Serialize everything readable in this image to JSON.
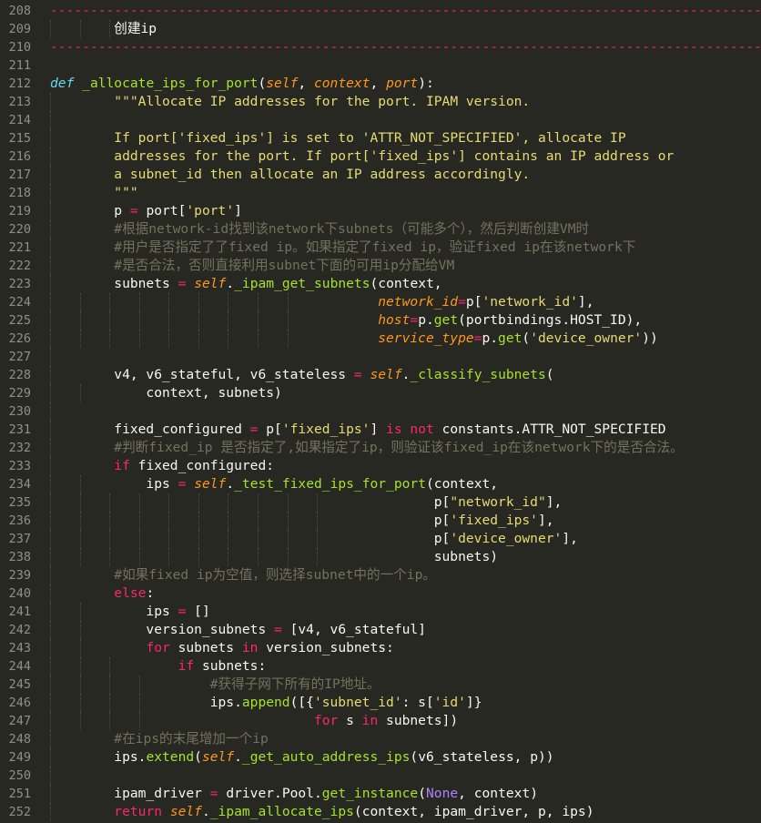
{
  "theme": {
    "background": "#272822",
    "foreground": "#f8f8f2",
    "keyword": "#f92672",
    "function": "#a6e22e",
    "parameter": "#fd971f",
    "string": "#e6db74",
    "comment": "#75715e",
    "builtin": "#66d9ef",
    "constant": "#ae81ff",
    "line_number": "#8f908a"
  },
  "editor": {
    "lines": [
      {
        "n": "208",
        "indent": 0,
        "tokens": [
          [
            "sep",
            "--------------------------------------------------------------------------------------------"
          ]
        ]
      },
      {
        "n": "209",
        "indent": 4,
        "tokens": [
          [
            "pl",
            "        创建ip"
          ]
        ]
      },
      {
        "n": "210",
        "indent": 0,
        "tokens": [
          [
            "sep",
            "--------------------------------------------------------------------------------------------"
          ]
        ]
      },
      {
        "n": "211",
        "indent": 0,
        "tokens": []
      },
      {
        "n": "212",
        "indent": 0,
        "tokens": [
          [
            "def",
            "def"
          ],
          [
            "pl",
            " "
          ],
          [
            "fn",
            "_allocate_ips_for_port"
          ],
          [
            "pl",
            "("
          ],
          [
            "param",
            "self"
          ],
          [
            "pl",
            ", "
          ],
          [
            "param",
            "context"
          ],
          [
            "pl",
            ", "
          ],
          [
            "param",
            "port"
          ],
          [
            "pl",
            "):"
          ]
        ]
      },
      {
        "n": "213",
        "indent": 1,
        "tokens": [
          [
            "pl",
            "        "
          ],
          [
            "ds",
            "\"\"\"Allocate IP addresses for the port. IPAM version."
          ]
        ]
      },
      {
        "n": "214",
        "indent": 1,
        "tokens": []
      },
      {
        "n": "215",
        "indent": 1,
        "tokens": [
          [
            "pl",
            "        "
          ],
          [
            "ds",
            "If port['fixed_ips'] is set to 'ATTR_NOT_SPECIFIED', allocate IP"
          ]
        ]
      },
      {
        "n": "216",
        "indent": 1,
        "tokens": [
          [
            "pl",
            "        "
          ],
          [
            "ds",
            "addresses for the port. If port['fixed_ips'] contains an IP address or"
          ]
        ]
      },
      {
        "n": "217",
        "indent": 1,
        "tokens": [
          [
            "pl",
            "        "
          ],
          [
            "ds",
            "a subnet_id then allocate an IP address accordingly."
          ]
        ]
      },
      {
        "n": "218",
        "indent": 1,
        "tokens": [
          [
            "pl",
            "        "
          ],
          [
            "ds",
            "\"\"\""
          ]
        ]
      },
      {
        "n": "219",
        "indent": 1,
        "tokens": [
          [
            "pl",
            "        p "
          ],
          [
            "op",
            "="
          ],
          [
            "pl",
            " port["
          ],
          [
            "str",
            "'port'"
          ],
          [
            "pl",
            "]"
          ]
        ]
      },
      {
        "n": "220",
        "indent": 1,
        "tokens": [
          [
            "pl",
            "        "
          ],
          [
            "cm",
            "#根据network-id找到该network下subnets（可能多个），然后判断创建VM时"
          ]
        ]
      },
      {
        "n": "221",
        "indent": 1,
        "tokens": [
          [
            "pl",
            "        "
          ],
          [
            "cm",
            "#用户是否指定了了fixed ip。如果指定了fixed ip，验证fixed ip在该network下"
          ]
        ]
      },
      {
        "n": "222",
        "indent": 1,
        "tokens": [
          [
            "pl",
            "        "
          ],
          [
            "cm",
            "#是否合法，否则直接利用subnet下面的可用ip分配给VM"
          ]
        ]
      },
      {
        "n": "223",
        "indent": 1,
        "tokens": [
          [
            "pl",
            "        subnets "
          ],
          [
            "op",
            "="
          ],
          [
            "pl",
            " "
          ],
          [
            "self",
            "self"
          ],
          [
            "pl",
            "."
          ],
          [
            "fn",
            "_ipam_get_subnets"
          ],
          [
            "pl",
            "(context,"
          ]
        ]
      },
      {
        "n": "224",
        "indent": 9,
        "tokens": [
          [
            "pl",
            "                                         "
          ],
          [
            "param",
            "network_id"
          ],
          [
            "op",
            "="
          ],
          [
            "pl",
            "p["
          ],
          [
            "str",
            "'network_id'"
          ],
          [
            "pl",
            "],"
          ]
        ]
      },
      {
        "n": "225",
        "indent": 9,
        "tokens": [
          [
            "pl",
            "                                         "
          ],
          [
            "param",
            "host"
          ],
          [
            "op",
            "="
          ],
          [
            "pl",
            "p."
          ],
          [
            "fn",
            "get"
          ],
          [
            "pl",
            "(portbindings.HOST_ID),"
          ]
        ]
      },
      {
        "n": "226",
        "indent": 9,
        "tokens": [
          [
            "pl",
            "                                         "
          ],
          [
            "param",
            "service_type"
          ],
          [
            "op",
            "="
          ],
          [
            "pl",
            "p."
          ],
          [
            "fn",
            "get"
          ],
          [
            "pl",
            "("
          ],
          [
            "str",
            "'device_owner'"
          ],
          [
            "pl",
            "))"
          ]
        ]
      },
      {
        "n": "227",
        "indent": 1,
        "tokens": []
      },
      {
        "n": "228",
        "indent": 1,
        "tokens": [
          [
            "pl",
            "        v4, v6_stateful, v6_stateless "
          ],
          [
            "op",
            "="
          ],
          [
            "pl",
            " "
          ],
          [
            "self",
            "self"
          ],
          [
            "pl",
            "."
          ],
          [
            "fn",
            "_classify_subnets"
          ],
          [
            "pl",
            "("
          ]
        ]
      },
      {
        "n": "229",
        "indent": 2,
        "tokens": [
          [
            "pl",
            "            context, subnets)"
          ]
        ]
      },
      {
        "n": "230",
        "indent": 1,
        "tokens": []
      },
      {
        "n": "231",
        "indent": 1,
        "tokens": [
          [
            "pl",
            "        fixed_configured "
          ],
          [
            "op",
            "="
          ],
          [
            "pl",
            " p["
          ],
          [
            "str",
            "'fixed_ips'"
          ],
          [
            "pl",
            "] "
          ],
          [
            "kw",
            "is"
          ],
          [
            "pl",
            " "
          ],
          [
            "kw",
            "not"
          ],
          [
            "pl",
            " constants.ATTR_NOT_SPECIFIED"
          ]
        ]
      },
      {
        "n": "232",
        "indent": 1,
        "tokens": [
          [
            "pl",
            "        "
          ],
          [
            "cm",
            "#判断fixed_ip 是否指定了,如果指定了ip，则验证该fixed_ip在该network下的是否合法。"
          ]
        ]
      },
      {
        "n": "233",
        "indent": 1,
        "tokens": [
          [
            "pl",
            "        "
          ],
          [
            "kw",
            "if"
          ],
          [
            "pl",
            " fixed_configured:"
          ]
        ]
      },
      {
        "n": "234",
        "indent": 2,
        "tokens": [
          [
            "pl",
            "            ips "
          ],
          [
            "op",
            "="
          ],
          [
            "pl",
            " "
          ],
          [
            "self",
            "self"
          ],
          [
            "pl",
            "."
          ],
          [
            "fn",
            "_test_fixed_ips_for_port"
          ],
          [
            "pl",
            "(context,"
          ]
        ]
      },
      {
        "n": "235",
        "indent": 10,
        "tokens": [
          [
            "pl",
            "                                                p["
          ],
          [
            "str",
            "\"network_id\""
          ],
          [
            "pl",
            "],"
          ]
        ]
      },
      {
        "n": "236",
        "indent": 10,
        "tokens": [
          [
            "pl",
            "                                                p["
          ],
          [
            "str",
            "'fixed_ips'"
          ],
          [
            "pl",
            "],"
          ]
        ]
      },
      {
        "n": "237",
        "indent": 10,
        "tokens": [
          [
            "pl",
            "                                                p["
          ],
          [
            "str",
            "'device_owner'"
          ],
          [
            "pl",
            "],"
          ]
        ]
      },
      {
        "n": "238",
        "indent": 10,
        "tokens": [
          [
            "pl",
            "                                                subnets)"
          ]
        ]
      },
      {
        "n": "239",
        "indent": 1,
        "tokens": [
          [
            "pl",
            "        "
          ],
          [
            "cm",
            "#如果fixed ip为空值，则选择subnet中的一个ip。"
          ]
        ]
      },
      {
        "n": "240",
        "indent": 1,
        "tokens": [
          [
            "pl",
            "        "
          ],
          [
            "kw",
            "else"
          ],
          [
            "pl",
            ":"
          ]
        ]
      },
      {
        "n": "241",
        "indent": 2,
        "tokens": [
          [
            "pl",
            "            ips "
          ],
          [
            "op",
            "="
          ],
          [
            "pl",
            " []"
          ]
        ]
      },
      {
        "n": "242",
        "indent": 2,
        "tokens": [
          [
            "pl",
            "            version_subnets "
          ],
          [
            "op",
            "="
          ],
          [
            "pl",
            " [v4, v6_stateful]"
          ]
        ]
      },
      {
        "n": "243",
        "indent": 2,
        "tokens": [
          [
            "pl",
            "            "
          ],
          [
            "kw",
            "for"
          ],
          [
            "pl",
            " subnets "
          ],
          [
            "kw",
            "in"
          ],
          [
            "pl",
            " version_subnets:"
          ]
        ]
      },
      {
        "n": "244",
        "indent": 3,
        "tokens": [
          [
            "pl",
            "                "
          ],
          [
            "kw",
            "if"
          ],
          [
            "pl",
            " subnets:"
          ]
        ]
      },
      {
        "n": "245",
        "indent": 4,
        "tokens": [
          [
            "pl",
            "                    "
          ],
          [
            "cm",
            "#获得子网下所有的IP地址。"
          ]
        ]
      },
      {
        "n": "246",
        "indent": 4,
        "tokens": [
          [
            "pl",
            "                    ips."
          ],
          [
            "fn",
            "append"
          ],
          [
            "pl",
            "([{"
          ],
          [
            "str",
            "'subnet_id'"
          ],
          [
            "pl",
            ": s["
          ],
          [
            "str",
            "'id'"
          ],
          [
            "pl",
            "]}"
          ]
        ]
      },
      {
        "n": "247",
        "indent": 4,
        "tokens": [
          [
            "pl",
            "                                 "
          ],
          [
            "kw",
            "for"
          ],
          [
            "pl",
            " s "
          ],
          [
            "kw",
            "in"
          ],
          [
            "pl",
            " subnets])"
          ]
        ]
      },
      {
        "n": "248",
        "indent": 1,
        "tokens": [
          [
            "pl",
            "        "
          ],
          [
            "cm",
            "#在ips的末尾增加一个ip"
          ]
        ]
      },
      {
        "n": "249",
        "indent": 1,
        "tokens": [
          [
            "pl",
            "        ips."
          ],
          [
            "fn",
            "extend"
          ],
          [
            "pl",
            "("
          ],
          [
            "self",
            "self"
          ],
          [
            "pl",
            "."
          ],
          [
            "fn",
            "_get_auto_address_ips"
          ],
          [
            "pl",
            "(v6_stateless, p))"
          ]
        ]
      },
      {
        "n": "250",
        "indent": 1,
        "tokens": []
      },
      {
        "n": "251",
        "indent": 1,
        "tokens": [
          [
            "pl",
            "        ipam_driver "
          ],
          [
            "op",
            "="
          ],
          [
            "pl",
            " driver.Pool."
          ],
          [
            "fn",
            "get_instance"
          ],
          [
            "pl",
            "("
          ],
          [
            "const",
            "None"
          ],
          [
            "pl",
            ", context)"
          ]
        ]
      },
      {
        "n": "252",
        "indent": 1,
        "tokens": [
          [
            "pl",
            "        "
          ],
          [
            "kw",
            "return"
          ],
          [
            "pl",
            " "
          ],
          [
            "self",
            "self"
          ],
          [
            "pl",
            "."
          ],
          [
            "fn",
            "_ipam_allocate_ips"
          ],
          [
            "pl",
            "(context, ipam_driver, p, ips)"
          ]
        ]
      }
    ]
  }
}
